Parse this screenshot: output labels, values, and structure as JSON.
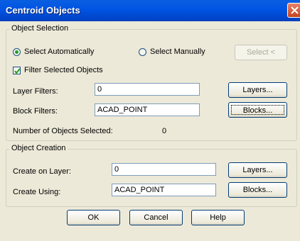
{
  "window": {
    "title": "Centroid Objects"
  },
  "object_selection": {
    "legend": "Object Selection",
    "radio_auto": {
      "label": "Select Automatically",
      "accel": "A",
      "selected": true
    },
    "radio_manual": {
      "label": "Select Manually",
      "accel": "M",
      "selected": false
    },
    "select_button": "Select <",
    "filter_checkbox": {
      "label": "Filter Selected Objects",
      "accel": "F",
      "checked": true
    },
    "layer_filters": {
      "label": "Layer Filters:",
      "accel": "L",
      "value": "0",
      "button": "Layers..."
    },
    "block_filters": {
      "label": "Block Filters:",
      "value": "ACAD_POINT",
      "button": "Blocks..."
    },
    "count": {
      "label": "Number of Objects Selected:",
      "value": "0"
    }
  },
  "object_creation": {
    "legend": "Object Creation",
    "create_on_layer": {
      "label": "Create on Layer:",
      "accel": "C",
      "value": "0",
      "button": "Layers..."
    },
    "create_using": {
      "label": "Create Using:",
      "value": "ACAD_POINT",
      "button": "Blocks..."
    }
  },
  "footer": {
    "ok": "OK",
    "cancel": "Cancel",
    "help": "Help"
  },
  "colors": {
    "titlebar": "#0054e3",
    "dialog_bg": "#ece9d8",
    "close_button": "#c4441f"
  }
}
